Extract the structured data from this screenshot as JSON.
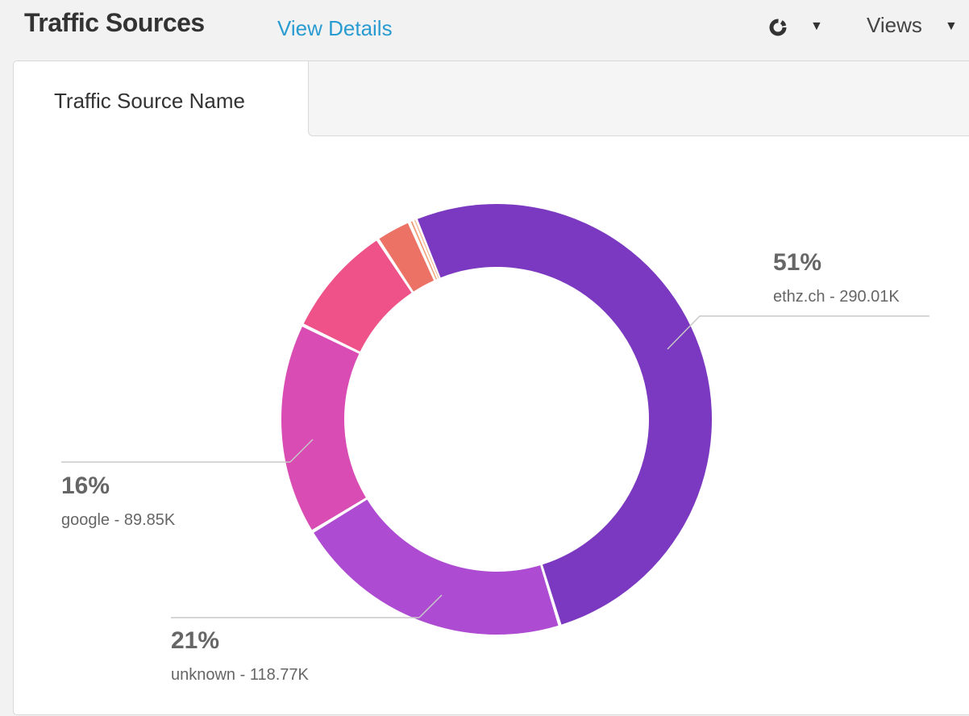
{
  "header": {
    "title": "Traffic Sources",
    "view_details": "View Details",
    "chart_type_icon": "donut-chart-icon",
    "views_label": "Views"
  },
  "tabs": [
    {
      "label": "Traffic Source Name",
      "active": true
    }
  ],
  "chart_data": {
    "type": "pie",
    "style": "donut",
    "slices": [
      {
        "name": "ethz.ch",
        "value_label": "290.01K",
        "value": 290.01,
        "percent": 51,
        "percent_label": "51%",
        "label": "ethz.ch - 290.01K",
        "color": "#7b38c0"
      },
      {
        "name": "unknown",
        "value_label": "118.77K",
        "value": 118.77,
        "percent": 21,
        "percent_label": "21%",
        "label": "unknown - 118.77K",
        "color": "#ad4bd2"
      },
      {
        "name": "google",
        "value_label": "89.85K",
        "value": 89.85,
        "percent": 16,
        "percent_label": "16%",
        "label": "google - 89.85K",
        "color": "#d94cb3"
      },
      {
        "value": 48.0,
        "percent": 8.4,
        "color": "#ee5288"
      },
      {
        "value": 15.0,
        "percent": 2.6,
        "color": "#ec7265"
      },
      {
        "value": 2.0,
        "percent": 0.4,
        "color": "#f09a70"
      },
      {
        "value": 1.0,
        "percent": 0.2,
        "color": "#f3b58c"
      }
    ],
    "labeled_slices": [
      {
        "percent_label": "51%",
        "label": "ethz.ch - 290.01K",
        "side": "right"
      },
      {
        "percent_label": "21%",
        "label": "unknown - 118.77K",
        "side": "left"
      },
      {
        "percent_label": "16%",
        "label": "google - 89.85K",
        "side": "left"
      }
    ]
  }
}
